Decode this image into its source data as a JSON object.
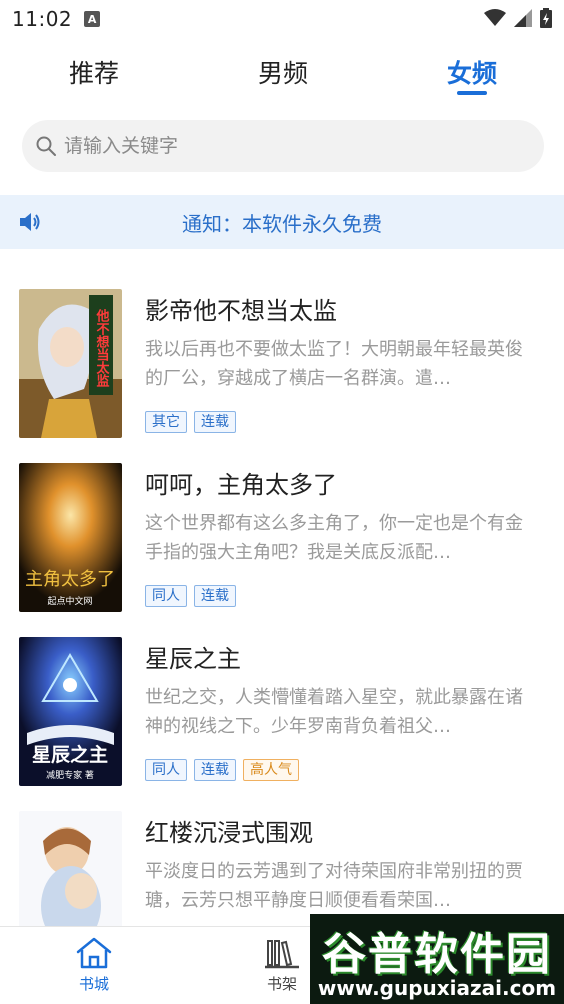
{
  "status_bar": {
    "time": "11:02",
    "badge": "A"
  },
  "tabs": [
    {
      "label": "推荐",
      "active": false
    },
    {
      "label": "男频",
      "active": false
    },
    {
      "label": "女频",
      "active": true
    }
  ],
  "search": {
    "placeholder": "请输入关键字"
  },
  "notice": {
    "text": "通知：本软件永久免费"
  },
  "books": [
    {
      "title": "影帝他不想当太监",
      "description": "我以后再也不要做太监了！大明朝最年轻最英俊的厂公，穿越成了横店一名群演。遣…",
      "tags": [
        "其它",
        "连载"
      ],
      "cover_text": "他不想当太监",
      "cover_colors": [
        "#d8c49a",
        "#6a7fae"
      ]
    },
    {
      "title": "呵呵，主角太多了",
      "description": "这个世界都有这么多主角了，你一定也是个有金手指的强大主角吧？我是关底反派配…",
      "tags": [
        "同人",
        "连载"
      ],
      "cover_text": "主角太多了",
      "cover_subtext": "起点中文网",
      "cover_colors": [
        "#1a1208",
        "#d8862a"
      ]
    },
    {
      "title": "星辰之主",
      "description": "世纪之交，人类懵懂着踏入星空，就此暴露在诸神的视线之下。少年罗南背负着祖父…",
      "tags": [
        "同人",
        "连载",
        "高人气"
      ],
      "cover_text": "星辰之主",
      "cover_subtext": "减肥专家 著",
      "cover_colors": [
        "#0b0f2a",
        "#3a5ec8"
      ]
    },
    {
      "title": "红楼沉浸式围观",
      "description": "平淡度日的云芳遇到了对待荣国府非常别扭的贾瑭，云芳只想平静度日顺便看看荣国…",
      "tags": [],
      "cover_colors": [
        "#f4f6fa",
        "#c9d8ec"
      ]
    }
  ],
  "bottom_nav": [
    {
      "label": "书城",
      "icon": "home-icon",
      "active": true
    },
    {
      "label": "书架",
      "icon": "bookshelf-icon",
      "active": false
    }
  ],
  "watermark": {
    "title": "谷普软件园",
    "url": "www.gupuxiazai.com"
  },
  "colors": {
    "accent": "#1a6ed8",
    "notice_bg": "#e9f2fc",
    "hot_tag": "#d98a1c"
  }
}
